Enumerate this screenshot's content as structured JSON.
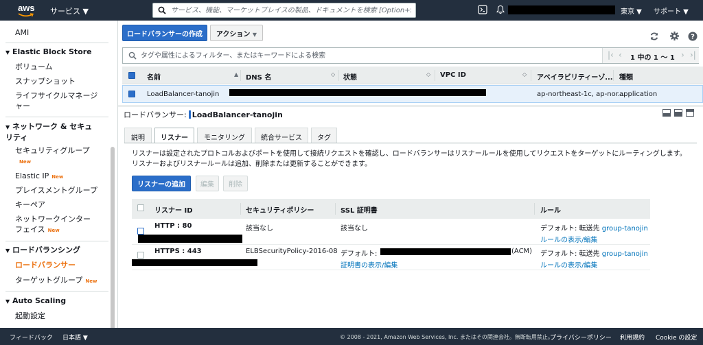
{
  "topnav": {
    "logo_text": "aws",
    "services_label": "サービス ▼",
    "search_placeholder": "サービス、機能、マーケットプレイスの製品、ドキュメントを検索 [Option+S]",
    "region_label": "東京 ▼",
    "support_label": "サポート ▼"
  },
  "sidebar": {
    "new_label": "New",
    "items": {
      "ami": "AMI",
      "ebs": "Elastic Block Store",
      "volumes": "ボリューム",
      "snapshots": "スナップショット",
      "lifecycle": "ライフサイクルマネージャー",
      "network": "ネットワーク & セキュリティ",
      "security_groups": "セキュリティグループ",
      "elastic_ip": "Elastic IP",
      "placement": "プレイスメントグループ",
      "keypair": "キーペア",
      "eni": "ネットワークインターフェイス",
      "lb_section": "ロードバランシング",
      "load_balancers": "ロードバランサー",
      "target_groups": "ターゲットグループ",
      "autoscaling": "Auto Scaling",
      "launch_config": "起動設定"
    }
  },
  "toolbar": {
    "create_lb": "ロードバランサーの作成",
    "actions": "アクション",
    "actions_caret": "▼"
  },
  "filter": {
    "placeholder": "タグや属性によるフィルター、またはキーワードによる検索",
    "pagination": "1 中の 1 〜 1"
  },
  "lb_table": {
    "headers": {
      "name": "名前",
      "dns": "DNS 名",
      "state": "状態",
      "vpc": "VPC ID",
      "az": "アベイラビリティーゾ...",
      "type": "種類"
    },
    "row": {
      "name": "LoadBalancer-tanojin",
      "az": "ap-northeast-1c, ap-nor...",
      "type": "application"
    }
  },
  "detail": {
    "label": "ロードバランサー:",
    "name": "LoadBalancer-tanojin",
    "tabs": [
      "説明",
      "リスナー",
      "モニタリング",
      "統合サービス",
      "タグ"
    ],
    "description_line1": "リスナーは設定されたプロトコルおよびポートを使用して接続リクエストを確認し、ロードバランサーはリスナールールを使用してリクエストをターゲットにルーティングします。",
    "description_line2": "リスナーおよびリスナールールは追加、削除または更新することができます。",
    "add_listener": "リスナーの追加",
    "edit": "編集",
    "delete": "削除"
  },
  "listeners": {
    "headers": {
      "id": "リスナー ID",
      "policy": "セキュリティポリシー",
      "ssl": "SSL 証明書",
      "rules": "ルール"
    },
    "rows": [
      {
        "id": "HTTP : 80",
        "policy": "該当なし",
        "ssl": "該当なし",
        "rule_prefix": "デフォルト: 転送先",
        "rule_target": "group-tanojin",
        "rule_link": "ルールの表示/編集"
      },
      {
        "id": "HTTPS : 443",
        "policy": "ELBSecurityPolicy-2016-08",
        "ssl_prefix": "デフォルト:",
        "ssl_suffix": "(ACM)",
        "ssl_link": "証明書の表示/編集",
        "rule_prefix": "デフォルト: 転送先",
        "rule_target": "group-tanojin",
        "rule_link": "ルールの表示/編集"
      }
    ]
  },
  "footer": {
    "feedback": "フィードバック",
    "language": "日本語 ▼",
    "copyright": "© 2008 - 2021, Amazon Web Services, Inc. またはその関連会社。無断転用禁止。",
    "privacy": "プライバシーポリシー",
    "terms": "利用規約",
    "cookie": "Cookie の設定"
  },
  "colors": {
    "nav_bg": "#232f3e",
    "primary_button": "#2b6ec9",
    "accent_orange": "#ec7211",
    "link": "#0073bb",
    "selected_row": "#e7f1fb"
  }
}
